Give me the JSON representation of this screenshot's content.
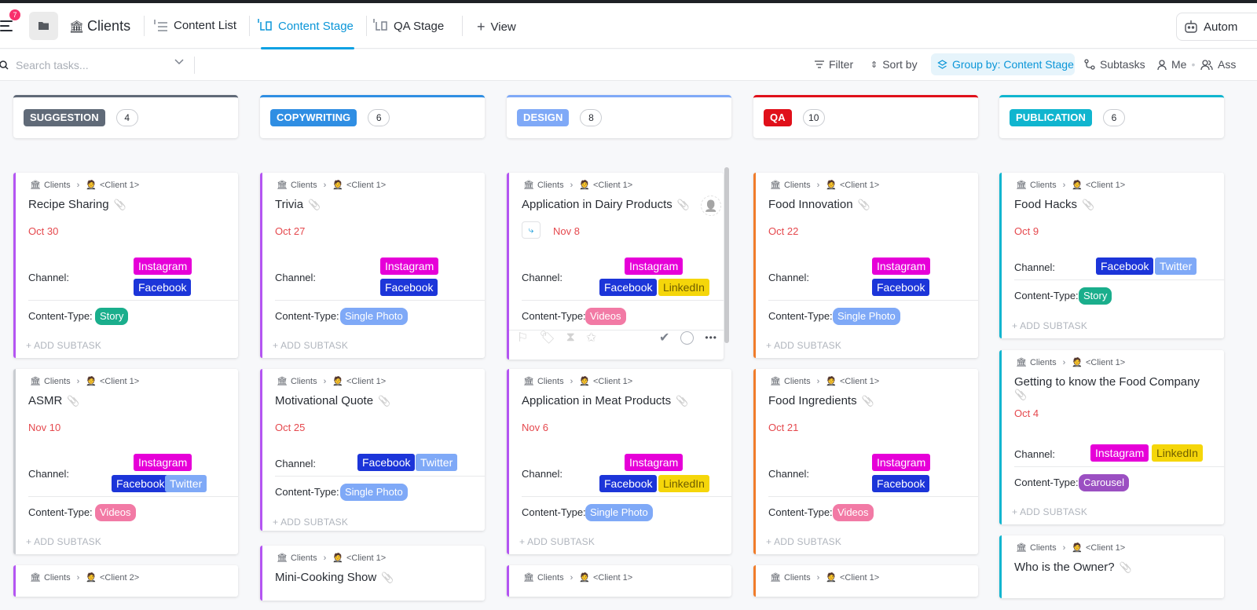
{
  "header": {
    "notif_count": "7",
    "space_title": "Clients",
    "tabs": [
      {
        "label": "Content List"
      },
      {
        "label": "Content Stage"
      },
      {
        "label": "QA Stage"
      },
      {
        "label": "View"
      }
    ],
    "automate_label": "Autom"
  },
  "toolbar": {
    "search_placeholder": "Search tasks...",
    "filter": "Filter",
    "sort": "Sort by",
    "group": "Group by: Content Stage",
    "subtasks": "Subtasks",
    "me": "Me",
    "assignees": "Ass"
  },
  "common": {
    "crumb_space": "Clients",
    "channel_label": "Channel:",
    "content_type_label": "Content-Type:",
    "add_subtask": "+ ADD SUBTASK"
  },
  "columns": [
    {
      "name": "SUGGESTION",
      "count": "4",
      "color": "#606a78",
      "cards": [
        {
          "client": "<Client 1>",
          "title": "Recipe Sharing",
          "date": "Oct 30",
          "channels": [
            "Instagram",
            "Facebook"
          ],
          "type": "Story"
        },
        {
          "client": "<Client 1>",
          "title": "ASMR",
          "date": "Nov 10",
          "channels": [
            "Instagram",
            "Facebook",
            "Twitter"
          ],
          "type": "Videos"
        },
        {
          "client": "<Client 2>"
        }
      ]
    },
    {
      "name": "COPYWRITING",
      "count": "6",
      "color": "#2f8ee3",
      "cards": [
        {
          "client": "<Client 1>",
          "title": "Trivia",
          "date": "Oct 27",
          "channels": [
            "Instagram",
            "Facebook"
          ],
          "type": "Single Photo"
        },
        {
          "client": "<Client 1>",
          "title": "Motivational Quote",
          "date": "Oct 25",
          "channels": [
            "Facebook",
            "Twitter"
          ],
          "type": "Single Photo"
        },
        {
          "client": "<Client 1>",
          "title": "Mini-Cooking Show"
        }
      ]
    },
    {
      "name": "DESIGN",
      "count": "8",
      "color": "#7fa9f7",
      "cards": [
        {
          "client": "<Client 1>",
          "title": "Application in Dairy Products",
          "date": "Nov 8",
          "channels": [
            "Instagram",
            "Facebook",
            "LinkedIn"
          ],
          "type": "Videos"
        },
        {
          "client": "<Client 1>",
          "title": "Application in Meat Products",
          "date": "Nov 6",
          "channels": [
            "Instagram",
            "Facebook",
            "LinkedIn"
          ],
          "type": "Single Photo"
        },
        {
          "client": "<Client 1>"
        }
      ]
    },
    {
      "name": "QA",
      "count": "10",
      "color": "#e0101a",
      "cards": [
        {
          "client": "<Client 1>",
          "title": "Food Innovation",
          "date": "Oct 22",
          "channels": [
            "Instagram",
            "Facebook"
          ],
          "type": "Single Photo"
        },
        {
          "client": "<Client 1>",
          "title": "Food Ingredients",
          "date": "Oct 21",
          "channels": [
            "Instagram",
            "Facebook"
          ],
          "type": "Videos"
        },
        {
          "client": "<Client 1>"
        }
      ]
    },
    {
      "name": "PUBLICATION",
      "count": "6",
      "color": "#10b5cf",
      "cards": [
        {
          "client": "<Client 1>",
          "title": "Food Hacks",
          "date": "Oct 9",
          "channels": [
            "Facebook",
            "Twitter"
          ],
          "type": "Story"
        },
        {
          "client": "<Client 1>",
          "title": "Getting to know the Food Company",
          "date": "Oct 4",
          "channels": [
            "Instagram",
            "LinkedIn"
          ],
          "type": "Carousel"
        },
        {
          "client": "<Client 1>",
          "title": "Who is the Owner?"
        }
      ]
    }
  ]
}
